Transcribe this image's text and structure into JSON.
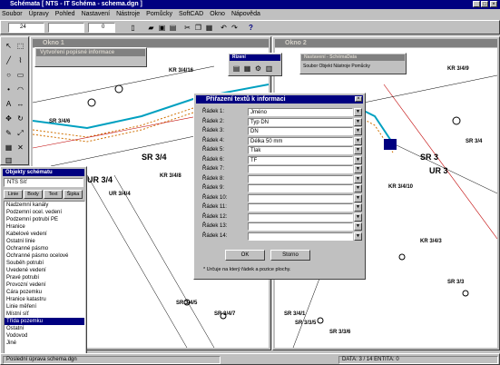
{
  "app": {
    "title": "Schémata [ NTS - IT Schéma - schema.dgn ]",
    "menu": [
      "Soubor",
      "Úpravy",
      "Pohled",
      "Nastavení",
      "Nástroje",
      "Pomůcky",
      "SoftCAD",
      "Okno",
      "Nápověda"
    ],
    "toolbar": {
      "level_value": "24",
      "weight_value": "0"
    }
  },
  "window1": {
    "title": "Okno 1"
  },
  "window2": {
    "title": "Okno 2"
  },
  "popis_dialog": {
    "title": "Vytvoření popisné informace"
  },
  "small_toolbar": {
    "title": "Řízení"
  },
  "window2_panel": {
    "title": "Nastavení - SchémaData",
    "row": "Soubor  Objekt  Nástroje  Pomůcky"
  },
  "objekty": {
    "title": "Objekty schématu",
    "combo_value": "NTS Síť",
    "tabs": [
      "Linie",
      "Body",
      "Text",
      "Šipka"
    ],
    "items": [
      "Nadzemní kanály",
      "Podzemní ocel. vedení",
      "Podzemní potrubí PE",
      "Hranice",
      "Kabelové vedení",
      "Ostatní linie",
      "Ochranné pásmo",
      "Ochranné pásmo ocelové",
      "Souběh potrubí",
      "Uvedené vedení",
      "Pravé potrubí",
      "Provozní vedení",
      "Čára pozemku",
      "Hranice katastru",
      "Linie měření",
      "Místní síť",
      "Třída pozemku",
      "Ostatní",
      "Vodovod",
      "Jiné"
    ],
    "selected_index": 16
  },
  "dialog": {
    "title": "Přiřazení textů k informaci",
    "rows": [
      {
        "label": "Řádek 1:",
        "value": "Jméno"
      },
      {
        "label": "Řádek 2:",
        "value": "Typ DN"
      },
      {
        "label": "Řádek 3:",
        "value": "DN"
      },
      {
        "label": "Řádek 4:",
        "value": "Délka 50 mm"
      },
      {
        "label": "Řádek 5:",
        "value": "Tlak"
      },
      {
        "label": "Řádek 6:",
        "value": "TF"
      },
      {
        "label": "Řádek 7:",
        "value": ""
      },
      {
        "label": "Řádek 8:",
        "value": ""
      },
      {
        "label": "Řádek 9:",
        "value": ""
      },
      {
        "label": "Řádek 10:",
        "value": ""
      },
      {
        "label": "Řádek 11:",
        "value": ""
      },
      {
        "label": "Řádek 12:",
        "value": ""
      },
      {
        "label": "Řádek 13:",
        "value": ""
      },
      {
        "label": "Řádek 14:",
        "value": ""
      }
    ],
    "ok_label": "OK",
    "cancel_label": "Storno",
    "footnote": "* Určuje na který řádek a pozice plochy."
  },
  "drawing_labels": {
    "w1": [
      "SR 3/4/6",
      "KR 3/4/16",
      "SR 3/4",
      "UR 3/4",
      "KR 3/4/8",
      "SR 3/4/5",
      "SR 3/4/7",
      "UR 3/4/4"
    ],
    "w2": [
      "KR 3/4/9",
      "SR 3",
      "SR 3/4",
      "UR 3",
      "KR 3/4/10",
      "KR 3/4/3",
      "SR 3/3",
      "SR 3/4/1",
      "SR 3/3/5",
      "SR 3/3/6"
    ]
  },
  "status": {
    "left": "Poslední úprava schema.dgn",
    "right": "DATA: 3 / 14 ENTITA: 0"
  }
}
